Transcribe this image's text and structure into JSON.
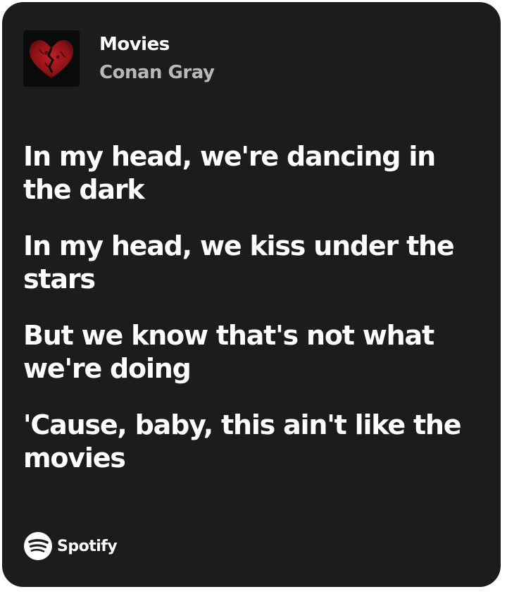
{
  "song": {
    "title": "Movies",
    "artist": "Conan Gray",
    "cover_icon": "broken-heart-cover"
  },
  "lyrics": [
    "In my head, we're dancing in the dark",
    "In my head, we kiss under the stars",
    "But we know that's not what we're doing",
    "'Cause, baby, this ain't like the movies"
  ],
  "brand": {
    "name": "Spotify",
    "icon": "spotify-icon"
  },
  "colors": {
    "card_background": "#1c1c1c",
    "title": "#ffffff",
    "artist": "#b8b8b8",
    "cover_heart": "#a3161b"
  }
}
